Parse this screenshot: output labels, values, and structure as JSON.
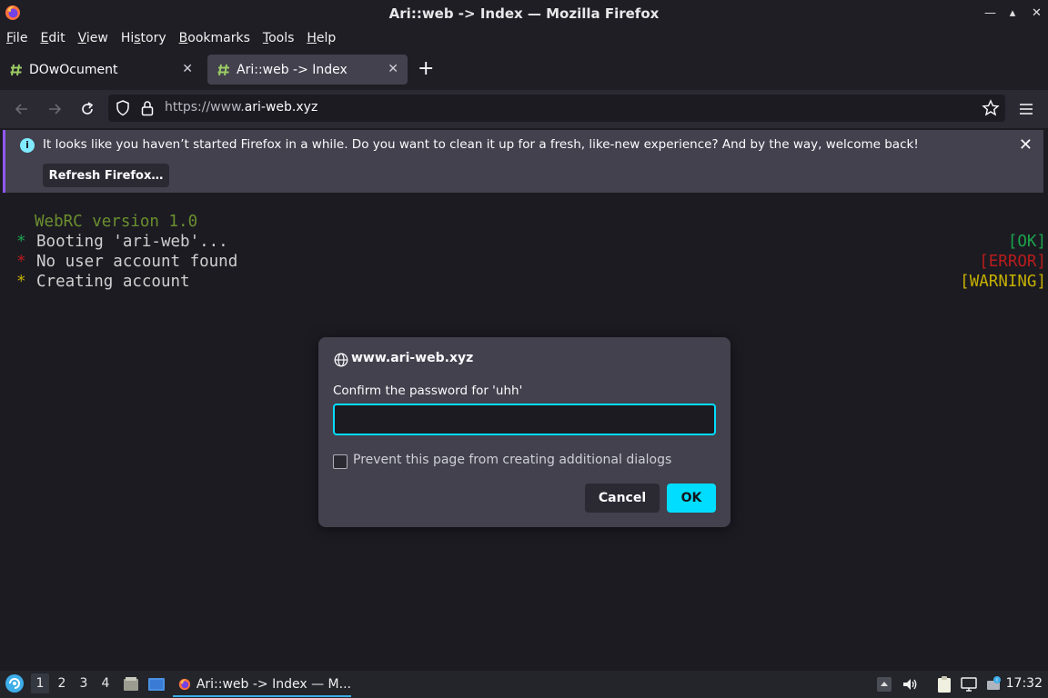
{
  "window": {
    "title": "Ari::web -> Index — Mozilla Firefox",
    "controls": [
      "minimize",
      "maximize",
      "close"
    ]
  },
  "menubar": {
    "items": [
      {
        "label": "File",
        "key": "F"
      },
      {
        "label": "Edit",
        "key": "E"
      },
      {
        "label": "View",
        "key": "V"
      },
      {
        "label": "History",
        "key": "s"
      },
      {
        "label": "Bookmarks",
        "key": "B"
      },
      {
        "label": "Tools",
        "key": "T"
      },
      {
        "label": "Help",
        "key": "H"
      }
    ]
  },
  "tabs": [
    {
      "label": "DOwOcument",
      "active": false,
      "favicon": "hashtag-icon"
    },
    {
      "label": "Ari::web -> Index",
      "active": true,
      "favicon": "hashtag-icon"
    }
  ],
  "navbar": {
    "url_prefix": "https://www.",
    "url_domain": "ari-web.xyz"
  },
  "notification": {
    "message": "It looks like you haven’t started Firefox in a while. Do you want to clean it up for a fresh, like-new experience? And by the way, welcome back!",
    "button_label": "Refresh Firefox…"
  },
  "terminal": {
    "version_line": "WebRC version 1.0",
    "lines": [
      {
        "star": "*",
        "text": "Booting 'ari-web'...",
        "status": "[OK]",
        "star_color": "#1aa44c",
        "status_color": "#1aa44c"
      },
      {
        "star": "*",
        "text": "No user account found",
        "status": "[ERROR]",
        "star_color": "#b91c1c",
        "status_color": "#b91c1c"
      },
      {
        "star": "*",
        "text": "Creating account",
        "status": "[WARNING]",
        "star_color": "#c4b000",
        "status_color": "#c4b000"
      }
    ]
  },
  "dialog": {
    "host": "www.ari-web.xyz",
    "prompt": "Confirm the password for 'uhh'",
    "input_value": "",
    "checkbox_label": "Prevent this page from creating additional dialogs",
    "checkbox_checked": false,
    "cancel_label": "Cancel",
    "ok_label": "OK"
  },
  "taskbar": {
    "workspaces": [
      "1",
      "2",
      "3",
      "4"
    ],
    "active_workspace": "1",
    "task_label": "Ari::web -> Index — M...",
    "clock": "17:32"
  },
  "colors": {
    "accent": "#00ddff",
    "notification_bar": "#9059ff",
    "version_text": "#6b8f2e"
  }
}
